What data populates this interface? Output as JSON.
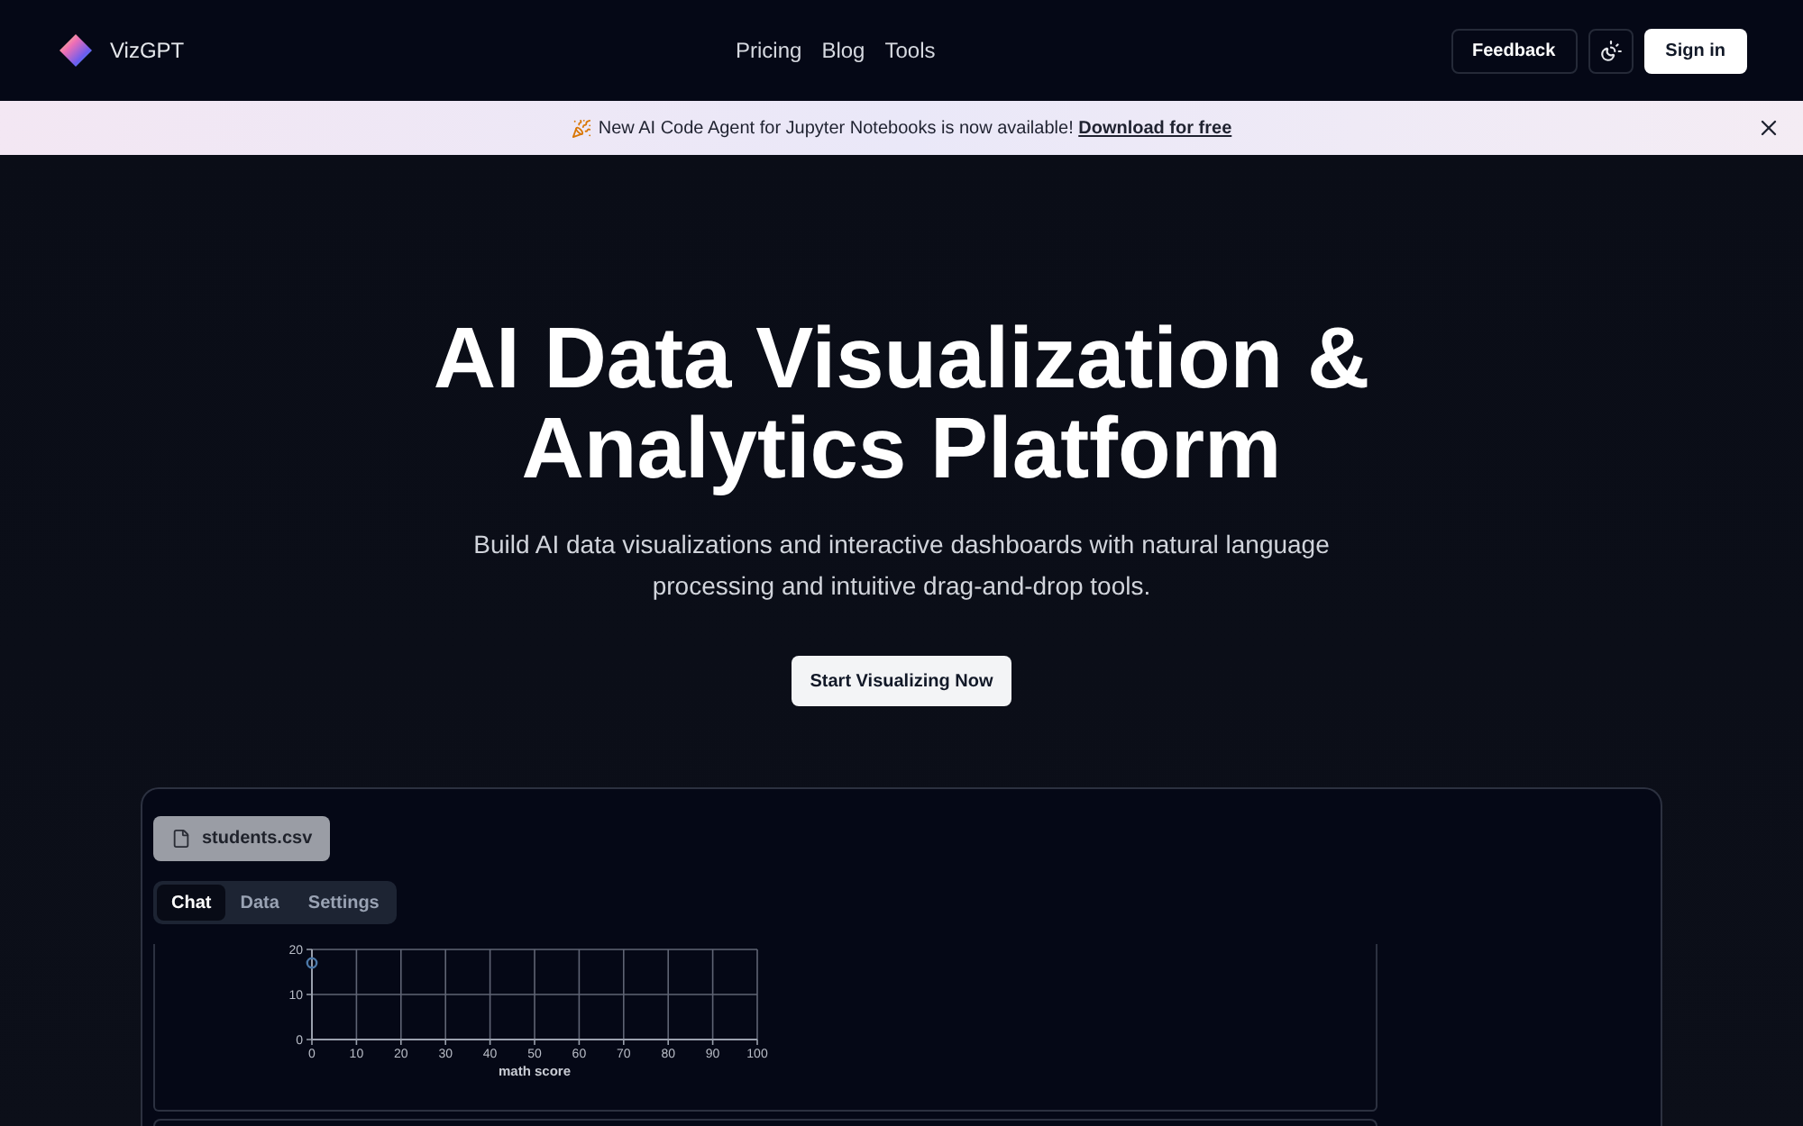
{
  "nav": {
    "brand": "VizGPT",
    "links": [
      "Pricing",
      "Blog",
      "Tools"
    ],
    "feedback": "Feedback",
    "sign_in": "Sign in"
  },
  "banner": {
    "text": "New AI Code Agent for Jupyter Notebooks is now available!",
    "link": "Download for free"
  },
  "hero": {
    "title": "AI Data Visualization & Analytics Platform",
    "subtitle": "Build AI data visualizations and interactive dashboards with natural language processing and intuitive drag-and-drop tools.",
    "cta": "Start Visualizing Now"
  },
  "demo": {
    "file": "students.csv",
    "tabs": [
      {
        "label": "Chat",
        "selected": true
      },
      {
        "label": "Data",
        "selected": false
      },
      {
        "label": "Settings",
        "selected": false
      }
    ],
    "chart_data": {
      "type": "scatter",
      "xlabel": "math score",
      "x": [
        0
      ],
      "values": [
        17
      ],
      "color": "#4c78a8",
      "xlim": [
        0,
        100
      ],
      "ylim": [
        0,
        20
      ],
      "xticks": [
        0,
        10,
        20,
        30,
        40,
        50,
        60,
        70,
        80,
        90,
        100
      ],
      "yticks": [
        0,
        10,
        20
      ],
      "grid": true,
      "marker": "hollow circle"
    }
  }
}
